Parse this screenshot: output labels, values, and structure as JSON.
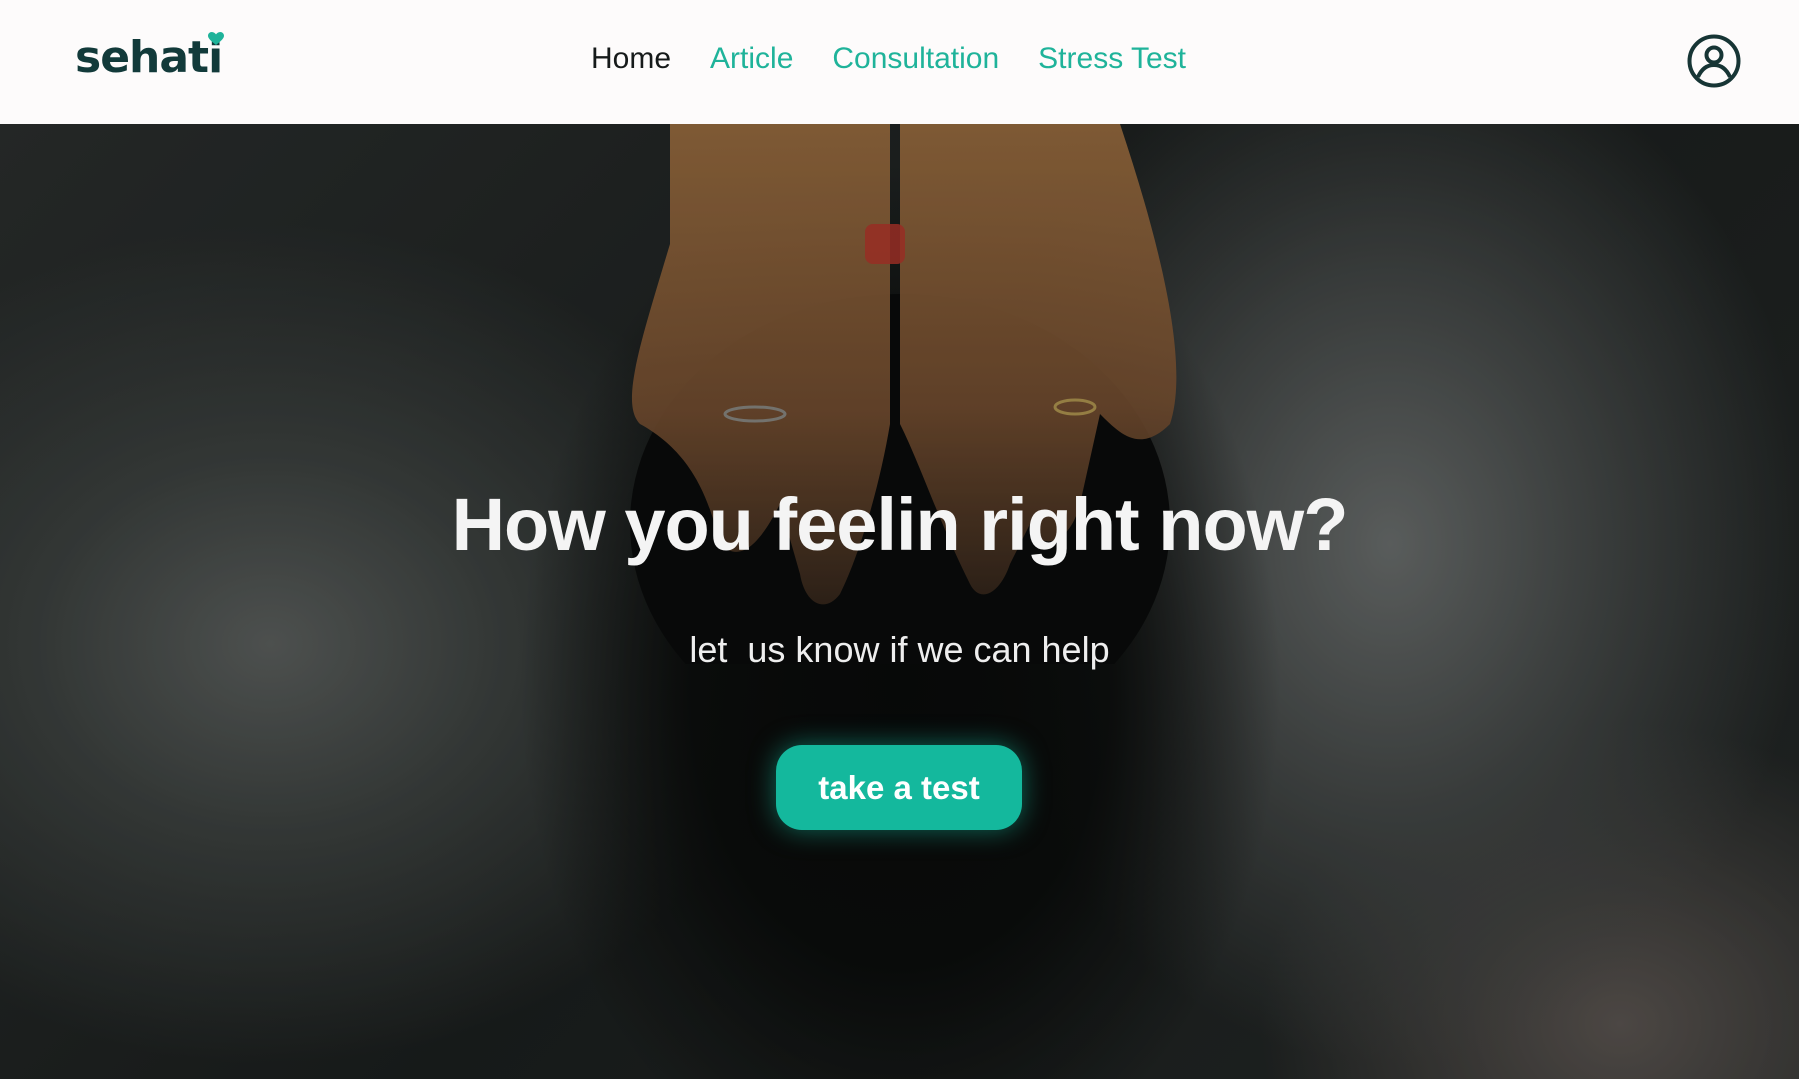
{
  "brand": {
    "name": "sehati",
    "logo_icon": "heart-icon",
    "accent": "#1fb39a"
  },
  "nav": {
    "items": [
      {
        "label": "Home",
        "active": true
      },
      {
        "label": "Article",
        "active": false
      },
      {
        "label": "Consultation",
        "active": false
      },
      {
        "label": "Stress Test",
        "active": false
      }
    ]
  },
  "profile": {
    "icon": "user-circle-icon"
  },
  "hero": {
    "title": "How you feelin right now?",
    "subtitle": "let  us know if we can help",
    "cta_label": "take a test",
    "cta_color": "#14b89d"
  }
}
